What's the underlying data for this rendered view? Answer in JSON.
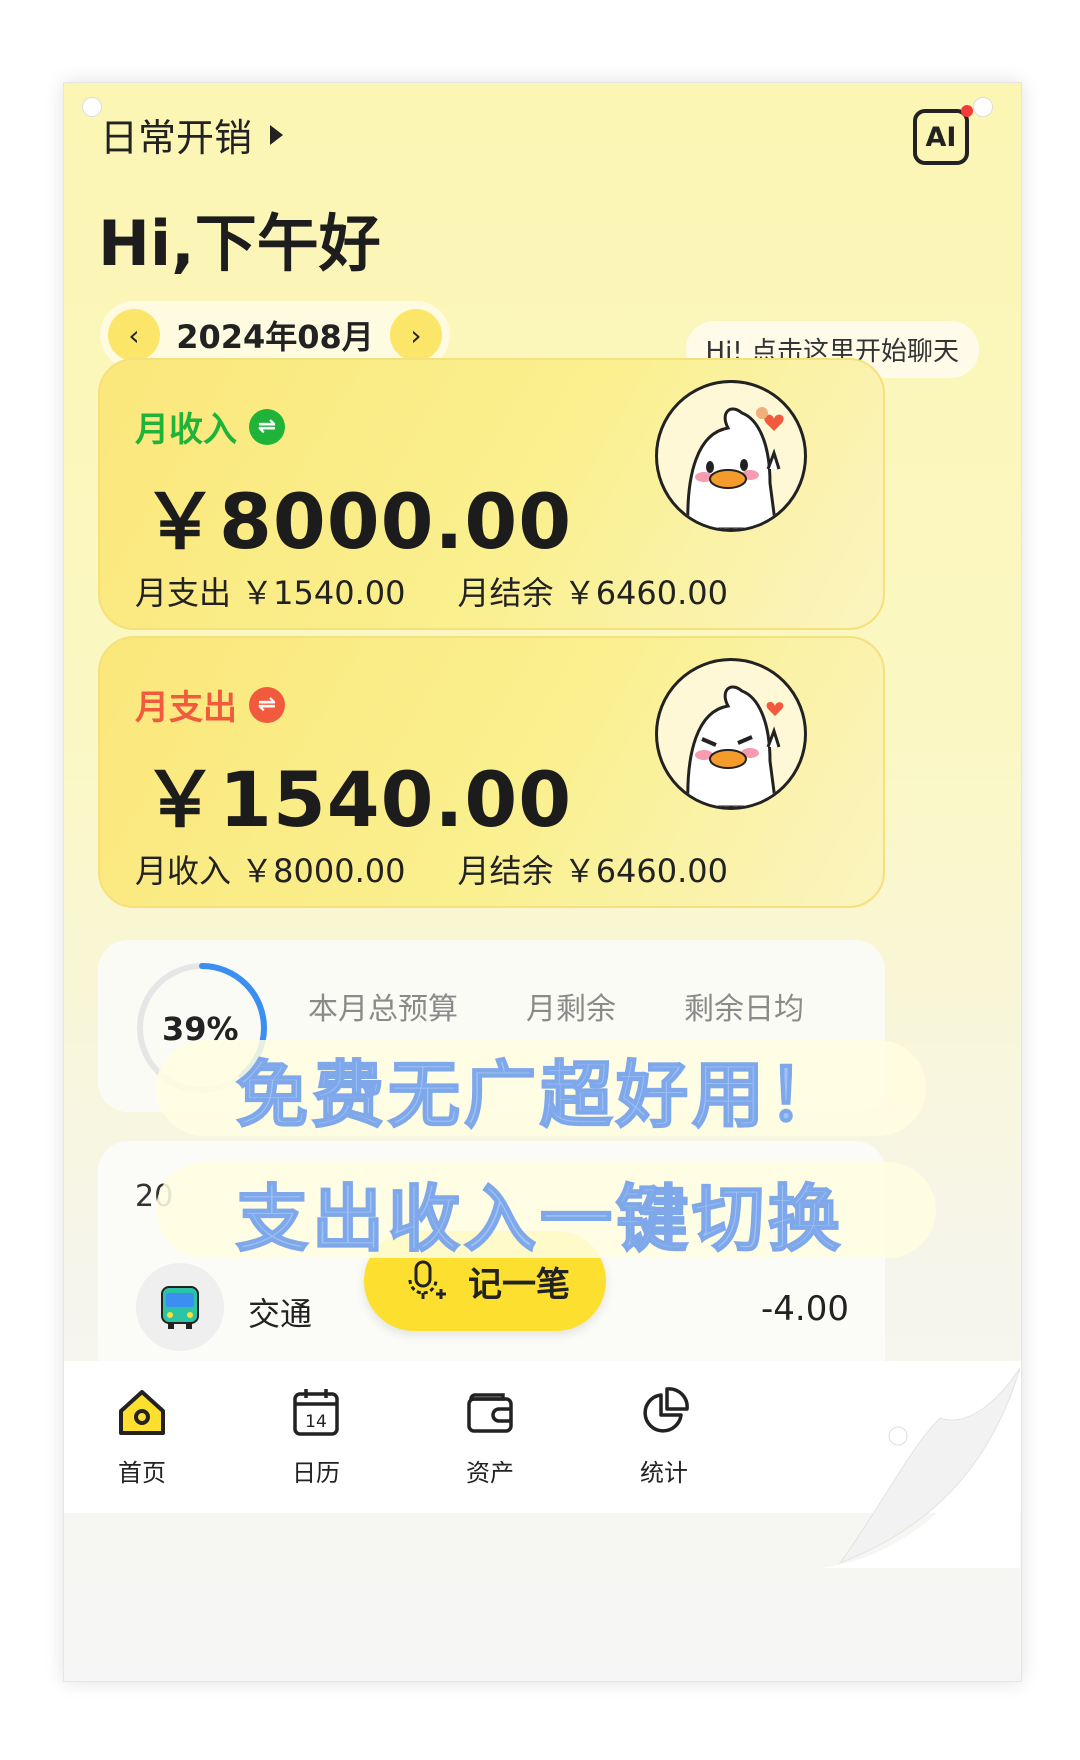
{
  "header": {
    "book_name": "日常开销",
    "ai_label": "AI",
    "greeting": "Hi,下午好"
  },
  "month_selector": {
    "prev": "‹",
    "month": "2024年08月",
    "next": "›"
  },
  "chat_bubble": "Hi! 点击这里开始聊天",
  "income_card": {
    "title": "月收入",
    "amount": "￥8000.00",
    "sub1": "月支出 ￥1540.00",
    "sub2": "月结余 ￥6460.00",
    "accent": "#1fb33a"
  },
  "expense_card": {
    "title": "月支出",
    "amount": "￥1540.00",
    "sub1": "月收入 ￥8000.00",
    "sub2": "月结余 ￥6460.00",
    "accent": "#f15a3c"
  },
  "budget": {
    "percent": "39%",
    "percent_value": 39,
    "heads": [
      "本月总预算",
      "月剩余",
      "剩余日均"
    ]
  },
  "list": {
    "date": "20",
    "category": "交通",
    "amount": "-4.00"
  },
  "record_button": "记一笔",
  "tabs": [
    {
      "label": "首页",
      "icon": "home-icon"
    },
    {
      "label": "日历",
      "icon": "calendar-icon",
      "icon_text": "14"
    },
    {
      "label": "资产",
      "icon": "wallet-icon"
    },
    {
      "label": "统计",
      "icon": "pie-chart-icon"
    }
  ],
  "overlay": {
    "line1": "免费无广超好用！",
    "line2": "支出收入一键切换"
  }
}
